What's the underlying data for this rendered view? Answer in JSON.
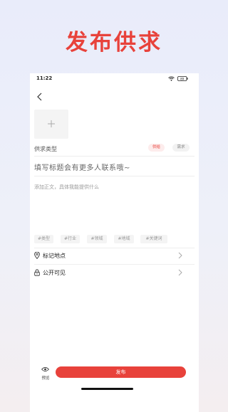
{
  "promo": {
    "title": "发布供求"
  },
  "status_bar": {
    "time": "11:22",
    "battery": "89"
  },
  "form": {
    "type_label": "供求类型",
    "type_options": [
      "供给",
      "需求"
    ],
    "selected_type": "供给",
    "title_placeholder": "填写标题会有更多人联系哦~",
    "body_placeholder": "添加正文，具体我能提供什么",
    "tag_chips": [
      "#类型",
      "#行业",
      "#领域",
      "#地域",
      "#关键词"
    ]
  },
  "rows": {
    "location": "标记地点",
    "visibility": "公开可见"
  },
  "bottom": {
    "preview_label": "预览",
    "publish_label": "发布"
  },
  "colors": {
    "accent": "#e8423b"
  }
}
